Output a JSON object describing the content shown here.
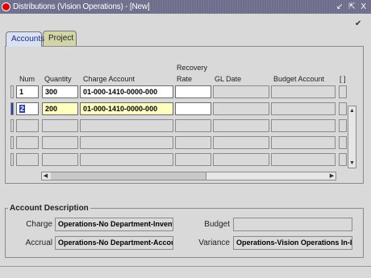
{
  "window": {
    "title": "Distributions (Vision Operations) - [New]",
    "buttons": "↙ ⇱ X",
    "check_mark": "✔"
  },
  "tabs": [
    {
      "label": "Accounts",
      "active": true
    },
    {
      "label": "Project",
      "active": false
    }
  ],
  "table": {
    "columns": {
      "num": "Num",
      "quantity": "Quantity",
      "charge_account": "Charge Account",
      "recovery_rate_line1": "Recovery",
      "recovery_rate_line2": "Rate",
      "gl_date": "GL Date",
      "budget_account": "Budget Account",
      "extra": "[ ]"
    },
    "rows": [
      {
        "num": "1",
        "quantity": "300",
        "charge_account": "01-000-1410-0000-000",
        "recovery_rate": "",
        "gl_date": "",
        "budget_account": ""
      },
      {
        "num": "2",
        "quantity": "200",
        "charge_account": "01-000-1410-0000-000",
        "recovery_rate": "",
        "gl_date": "",
        "budget_account": ""
      },
      {
        "num": "",
        "quantity": "",
        "charge_account": "",
        "recovery_rate": "",
        "gl_date": "",
        "budget_account": ""
      },
      {
        "num": "",
        "quantity": "",
        "charge_account": "",
        "recovery_rate": "",
        "gl_date": "",
        "budget_account": ""
      },
      {
        "num": "",
        "quantity": "",
        "charge_account": "",
        "recovery_rate": "",
        "gl_date": "",
        "budget_account": ""
      }
    ]
  },
  "account_description": {
    "legend": "Account Description",
    "charge_label": "Charge",
    "charge_value": "Operations-No Department-Inventory",
    "accrual_label": "Accrual",
    "accrual_value": "Operations-No Department-Accounts I",
    "budget_label": "Budget",
    "budget_value": "",
    "variance_label": "Variance",
    "variance_value": "Operations-Vision Operations In-Invoi"
  },
  "colors": {
    "titlebar": "#6d6d8c",
    "active_tab": "#d9e2f3",
    "inactive_tab": "#d2d5a8",
    "selected_cell": "#ffffc0",
    "selection": "#2a3ea8"
  }
}
